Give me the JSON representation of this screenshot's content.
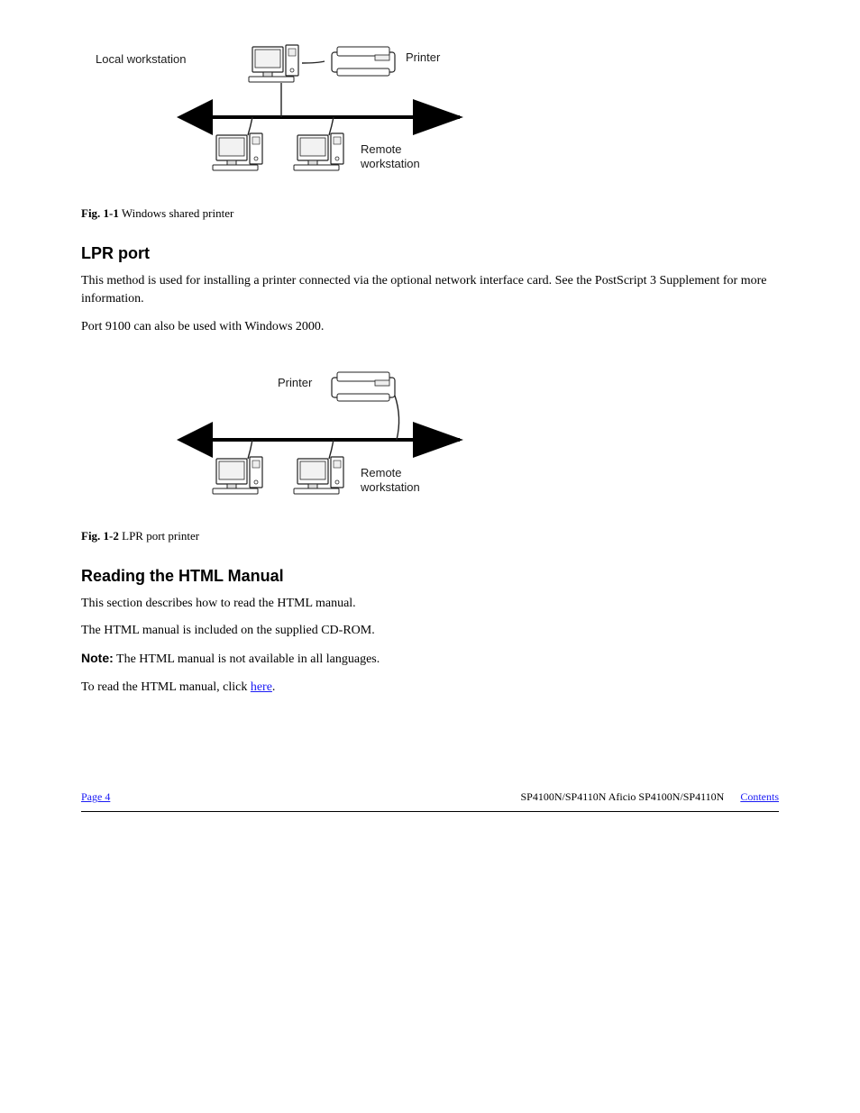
{
  "figure1": {
    "caption_label": "Fig. 1-1",
    "caption_text": "Windows shared printer",
    "labels": {
      "local": "Local workstation",
      "printer": "Printer",
      "remote_1": "Remote",
      "remote_2": "workstation"
    }
  },
  "section1": {
    "heading": "LPR port",
    "p1": "This method is used for installing a printer connected via the optional network interface card. See the PostScript 3 Supplement for more information.",
    "p2": "Port 9100 can also be used with Windows 2000."
  },
  "figure2": {
    "caption_label": "Fig. 1-2",
    "caption_text": "LPR port printer",
    "labels": {
      "printer": "Printer",
      "remote_1": "Remote",
      "remote_2": "workstation"
    }
  },
  "section2": {
    "heading": "Reading the HTML Manual",
    "p1": "This section describes how to read the HTML manual.",
    "p2": "The HTML manual is included on the supplied CD-ROM.",
    "note_label": "Note:",
    "note_text": " The HTML manual is not available in all languages.",
    "link1_pre": "To read the HTML manual, click ",
    "link1": "here",
    "link1_post": "."
  },
  "footer": {
    "page_link": "Page 4",
    "product": "SP4100N/SP4110N Aficio SP4100N/SP4110N",
    "contents": "Contents"
  }
}
